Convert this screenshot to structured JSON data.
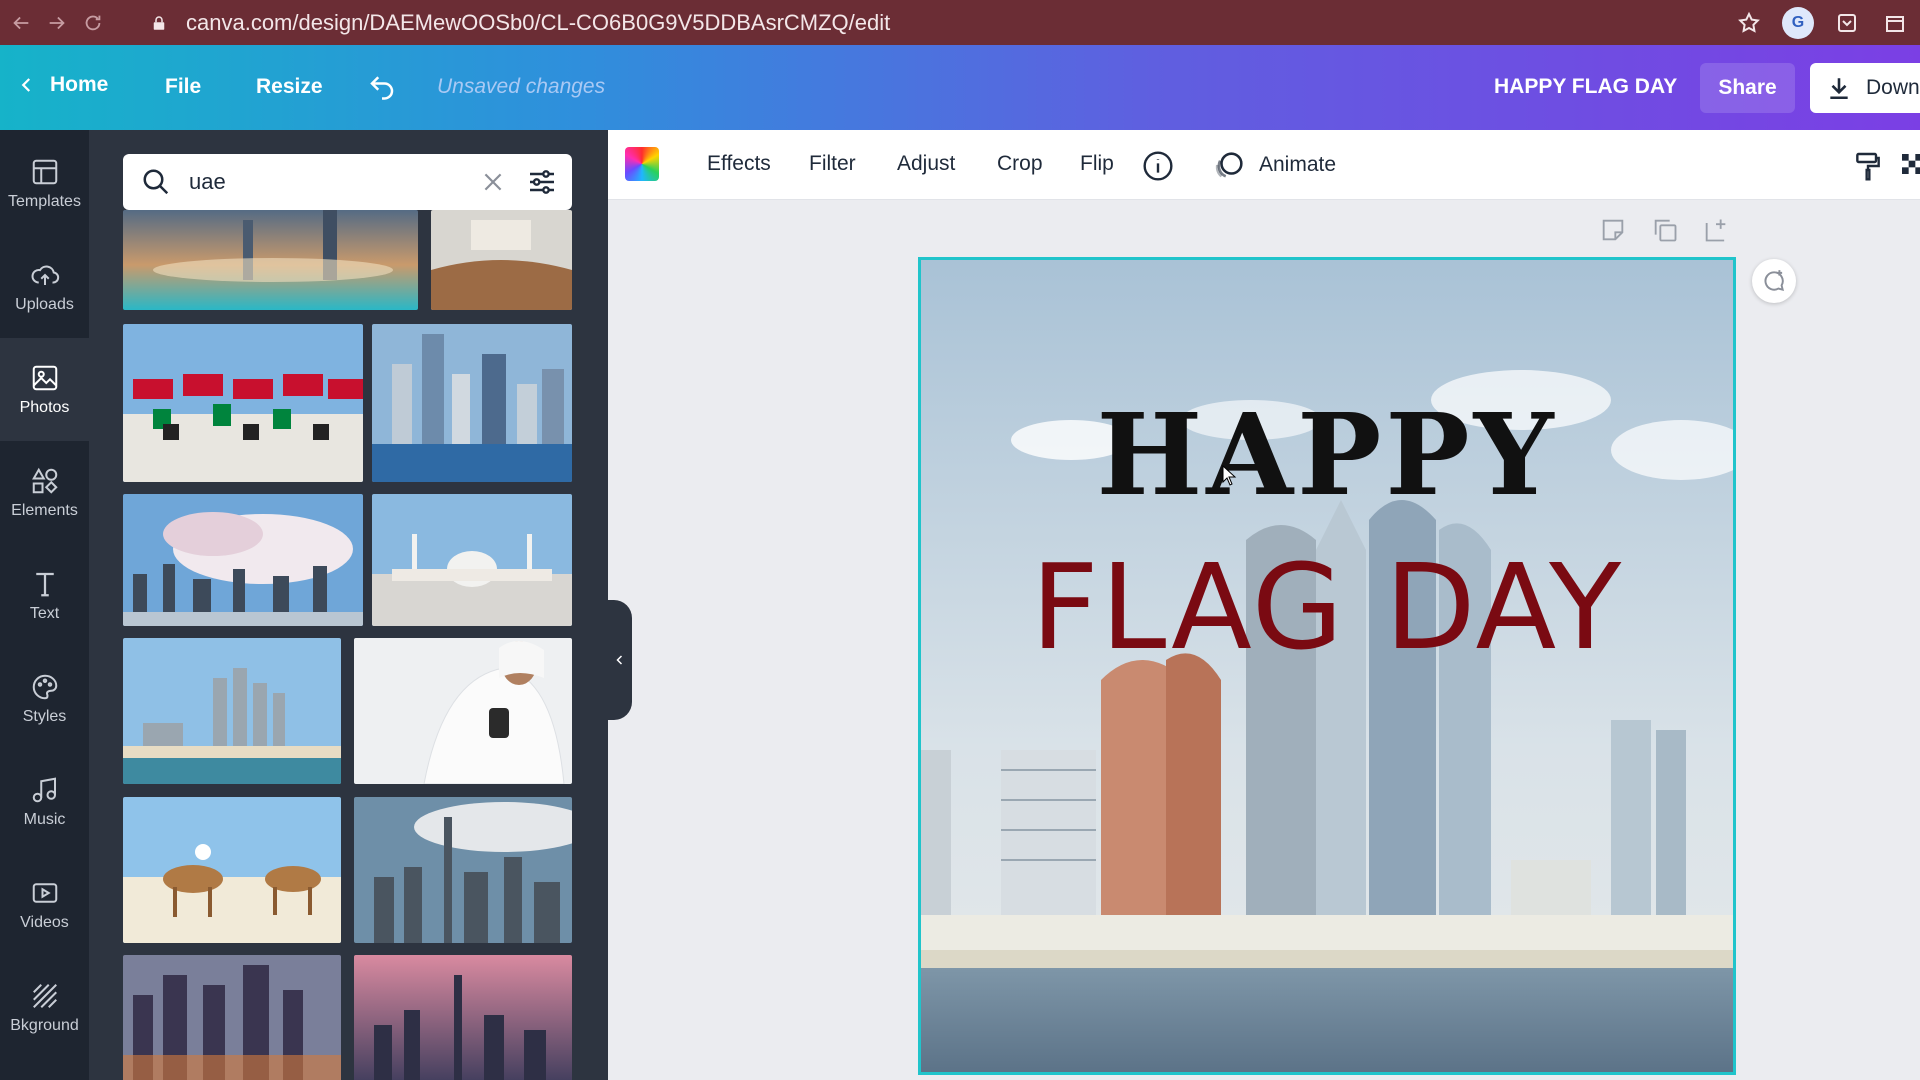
{
  "browser": {
    "url": "canva.com/design/DAEMewOOSb0/CL-CO6B0G9V5DDBAsrCMZQ/edit"
  },
  "header": {
    "home_label": "Home",
    "file_label": "File",
    "resize_label": "Resize",
    "status_text": "Unsaved changes",
    "design_title": "HAPPY FLAG DAY",
    "share_label": "Share",
    "download_label": "Down"
  },
  "sidebar": {
    "items": [
      {
        "label": "Templates",
        "icon": "templates-icon"
      },
      {
        "label": "Uploads",
        "icon": "upload-cloud-icon"
      },
      {
        "label": "Photos",
        "icon": "photos-icon"
      },
      {
        "label": "Elements",
        "icon": "elements-icon"
      },
      {
        "label": "Text",
        "icon": "text-icon"
      },
      {
        "label": "Styles",
        "icon": "palette-icon"
      },
      {
        "label": "Music",
        "icon": "music-icon"
      },
      {
        "label": "Videos",
        "icon": "video-icon"
      },
      {
        "label": "Bkground",
        "icon": "background-icon"
      }
    ],
    "active": "Photos"
  },
  "search": {
    "query": "uae"
  },
  "toolbar": {
    "effects": "Effects",
    "filter": "Filter",
    "adjust": "Adjust",
    "crop": "Crop",
    "flip": "Flip",
    "animate": "Animate"
  },
  "design": {
    "line1": "HAPPY",
    "line2": "FLAG DAY",
    "line1_color": "#111111",
    "line2_color": "#7a0a12",
    "selection_color": "#20c4cb"
  },
  "colors": {
    "browser_bar": "#6b2d35",
    "rail": "#1e2530",
    "panel": "#2d3440"
  }
}
